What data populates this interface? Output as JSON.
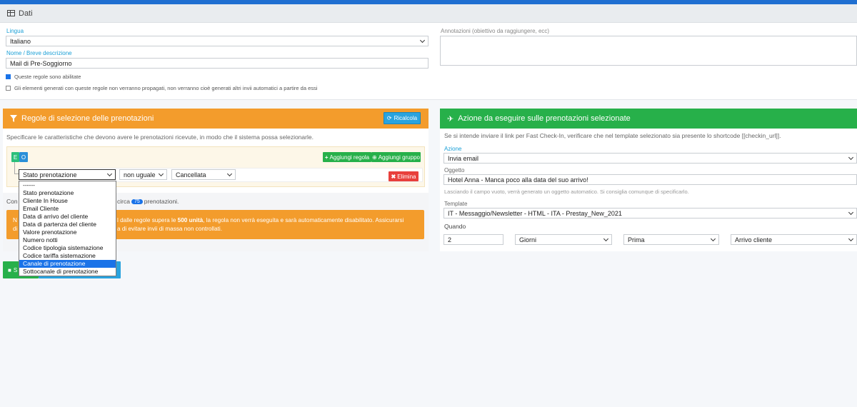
{
  "dati": {
    "title": "Dati",
    "lingua_label": "Lingua",
    "lingua_value": "Italiano",
    "nome_label": "Nome / Breve descrizione",
    "nome_value": "Mail di Pre-Soggiorno",
    "annotazioni_label": "Annotazioni (obiettivo da raggiungere, ecc)",
    "check_enabled_label": "Queste regole sono abilitate",
    "check_propagate_label": "Gli elementi generati con queste regole non verranno propagati, non verranno cioè generati altri invii automatici a partire da essi"
  },
  "regole": {
    "title": "Regole di selezione delle prenotazioni",
    "ricalcola_label": "Ricalcola",
    "description": "Specificare le caratteristiche che devono avere le prenotazioni ricevute, in modo che il sistema possa selezionarle.",
    "tag_e": "E",
    "tag_o": "O",
    "aggiungi_regola": "Aggiungi regola",
    "aggiungi_gruppo": "Aggiungi gruppo",
    "field_value": "Stato prenotazione",
    "operator_value": "non uguale",
    "value_value": "Cancellata",
    "elimina": "Elimina",
    "count_prefix": "Con",
    "count_mid": "circa",
    "count_value": "75",
    "count_suffix": "prenotazioni.",
    "warning_line1_start": "N",
    "warning_line1_main": "l dalle regole supera le",
    "warning_bold": "500 unità",
    "warning_line1_end": ", la regola non verrà eseguita e sarà automaticamente disabilitato. Assicurarsi",
    "warning_line2_start": "di",
    "warning_line2_main": "a di evitare invii di massa non controllati.",
    "dropdown_options": [
      "------",
      "Stato prenotazione",
      "Cliente In House",
      "Email Cliente",
      "Data di arrivo del cliente",
      "Data di partenza del cliente",
      "Valore prenotazione",
      "Numero notti",
      "Codice tipologia sistemazione",
      "Codice tariffa sistemazione",
      "Canale di prenotazione",
      "Sottocanale di prenotazione"
    ],
    "dropdown_selected_index": 10,
    "save_button": "S"
  },
  "azione": {
    "title": "Azione da eseguire sulle prenotazioni selezionate",
    "description": "Se si intende inviare il link per Fast Check-In, verificare che nel template selezionato sia presente lo shortcode [[checkin_url]].",
    "azione_label": "Azione",
    "azione_value": "Invia email",
    "oggetto_label": "Oggetto",
    "oggetto_value": "Hotel Anna - Manca poco alla data del suo arrivo!",
    "oggetto_hint": "Lasciando il campo vuoto, verrà generato un oggetto automatico. Si consiglia comunque di specificarlo.",
    "template_label": "Template",
    "template_value": "IT - Messaggio/Newsletter - HTML - ITA - Prestay_New_2021",
    "quando_label": "Quando",
    "quando_number": "2",
    "quando_unit": "Giorni",
    "quando_when": "Prima",
    "quando_ref": "Arrivo cliente"
  },
  "colors": {
    "orange": "#f39c2c",
    "green": "#27b04a",
    "blue": "#1a73e8",
    "red": "#e8403c"
  }
}
